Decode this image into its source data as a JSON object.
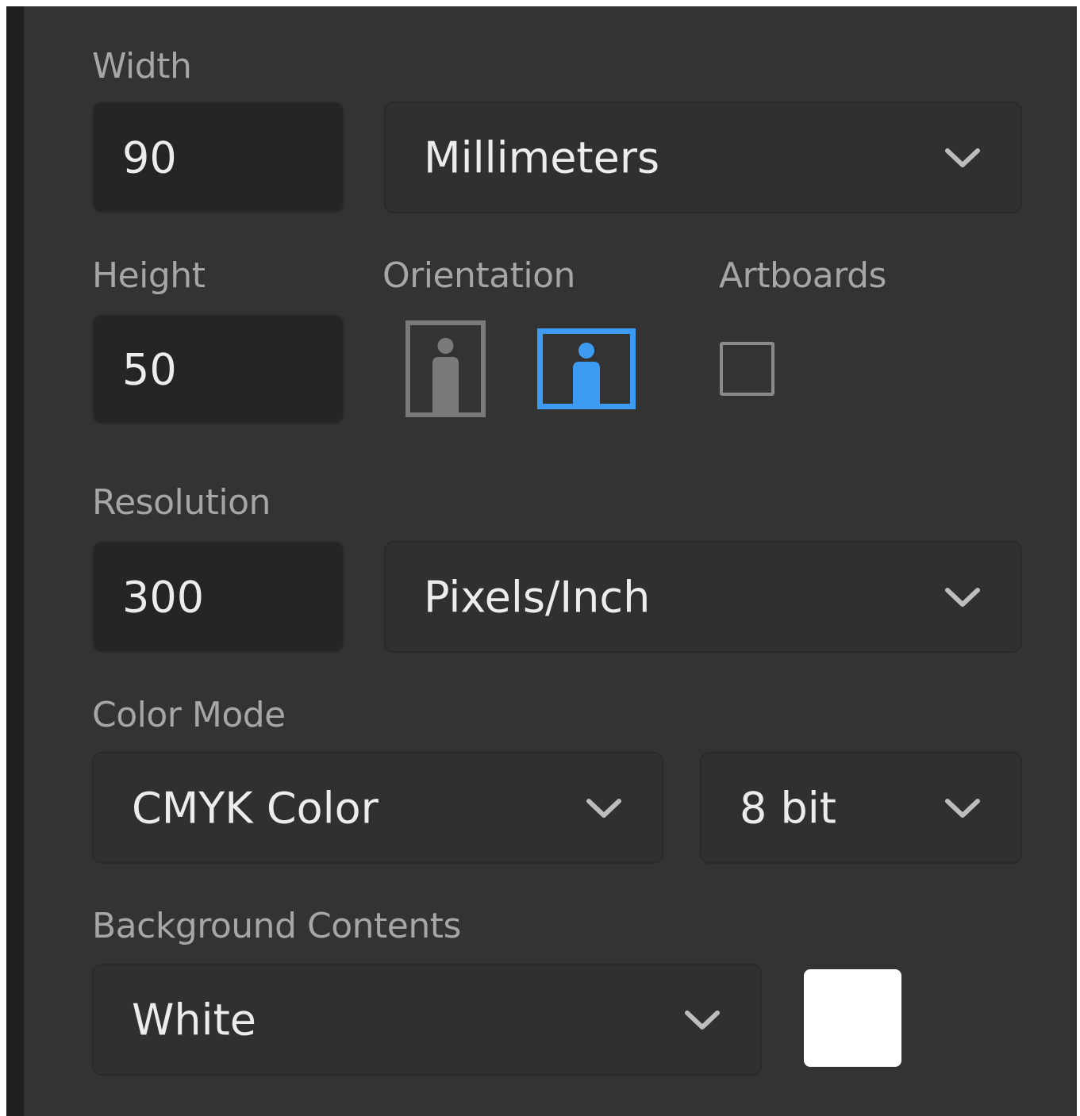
{
  "width": {
    "label": "Width",
    "value": "90",
    "unit": "Millimeters"
  },
  "height": {
    "label": "Height",
    "value": "50"
  },
  "orientation": {
    "label": "Orientation",
    "selected": "landscape",
    "options": [
      "portrait",
      "landscape"
    ]
  },
  "artboards": {
    "label": "Artboards",
    "checked": false
  },
  "resolution": {
    "label": "Resolution",
    "value": "300",
    "unit": "Pixels/Inch"
  },
  "color_mode": {
    "label": "Color Mode",
    "mode": "CMYK Color",
    "depth": "8 bit"
  },
  "background": {
    "label": "Background Contents",
    "value": "White",
    "swatch_color": "#ffffff"
  },
  "colors": {
    "panel_bg": "#333333",
    "accent": "#3d9cf2",
    "icon_grey": "#7a7a7a"
  },
  "icons": {
    "dropdown": "chevron-down-icon",
    "portrait": "portrait-orientation-icon",
    "landscape": "landscape-orientation-icon"
  }
}
